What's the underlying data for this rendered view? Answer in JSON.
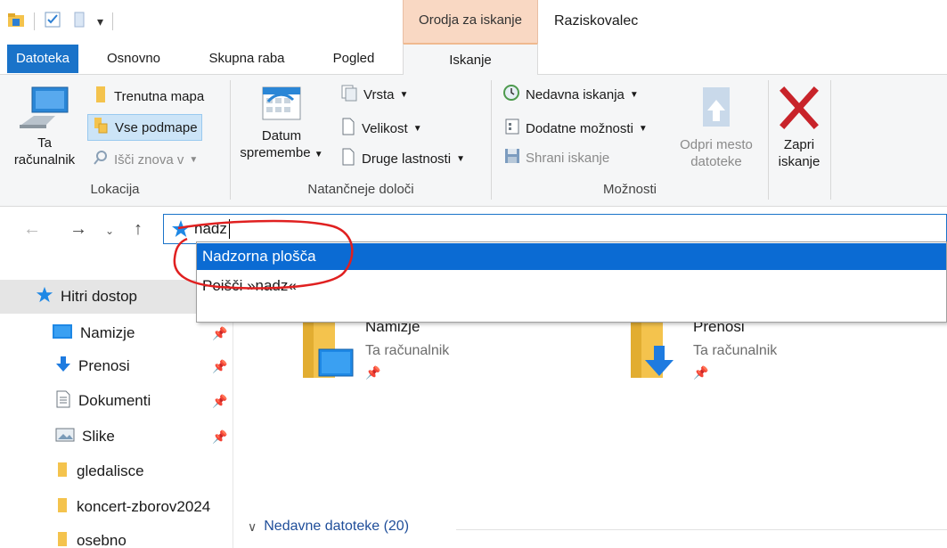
{
  "titlebar": {
    "context_group": "Orodja za iskanje",
    "app_title": "Raziskovalec"
  },
  "tabs": [
    {
      "label": "Datoteka"
    },
    {
      "label": "Osnovno"
    },
    {
      "label": "Skupna raba"
    },
    {
      "label": "Pogled"
    },
    {
      "label": "Iskanje"
    }
  ],
  "ribbon": {
    "lokacija": {
      "group_label": "Lokacija",
      "this_pc_line1": "Ta",
      "this_pc_line2": "računalnik",
      "current_folder": "Trenutna mapa",
      "all_subfolders": "Vse podmape",
      "search_again": "Išči znova v"
    },
    "refine": {
      "group_label": "Natančneje določi",
      "date_modified_line1": "Datum",
      "date_modified_line2": "spremembe",
      "kind": "Vrsta",
      "size": "Velikost",
      "other_properties": "Druge lastnosti"
    },
    "options": {
      "group_label": "Možnosti",
      "recent_searches": "Nedavna iskanja",
      "advanced_options": "Dodatne možnosti",
      "save_search": "Shrani iskanje",
      "open_location_line1": "Odpri mesto",
      "open_location_line2": "datoteke"
    },
    "close": {
      "line1": "Zapri",
      "line2": "iskanje"
    }
  },
  "address": {
    "value": "nadz"
  },
  "suggestions": [
    {
      "label": "Nadzorna plošča"
    },
    {
      "label": "Poišči »nadz«"
    }
  ],
  "sidebar": {
    "items": [
      {
        "label": "Hitri dostop",
        "icon": "star-icon"
      },
      {
        "label": "Namizje",
        "icon": "desktop-icon",
        "pinned": true
      },
      {
        "label": "Prenosi",
        "icon": "download-icon",
        "pinned": true
      },
      {
        "label": "Dokumenti",
        "icon": "document-icon",
        "pinned": true
      },
      {
        "label": "Slike",
        "icon": "pictures-icon",
        "pinned": true
      },
      {
        "label": "gledalisce",
        "icon": "folder-icon"
      },
      {
        "label": "koncert-zborov2024",
        "icon": "folder-icon"
      },
      {
        "label": "osebno",
        "icon": "folder-icon"
      }
    ]
  },
  "content": {
    "tiles": [
      {
        "title": "Namizje",
        "subtitle": "Ta računalnik"
      },
      {
        "title": "Prenosi",
        "subtitle": "Ta računalnik"
      }
    ],
    "recent_section": "Nedavne datoteke (20)"
  },
  "colors": {
    "accent": "#1a73c9",
    "context_tab": "#f9d8c3",
    "annotation": "#e02020",
    "folder": "#f4c34d"
  }
}
